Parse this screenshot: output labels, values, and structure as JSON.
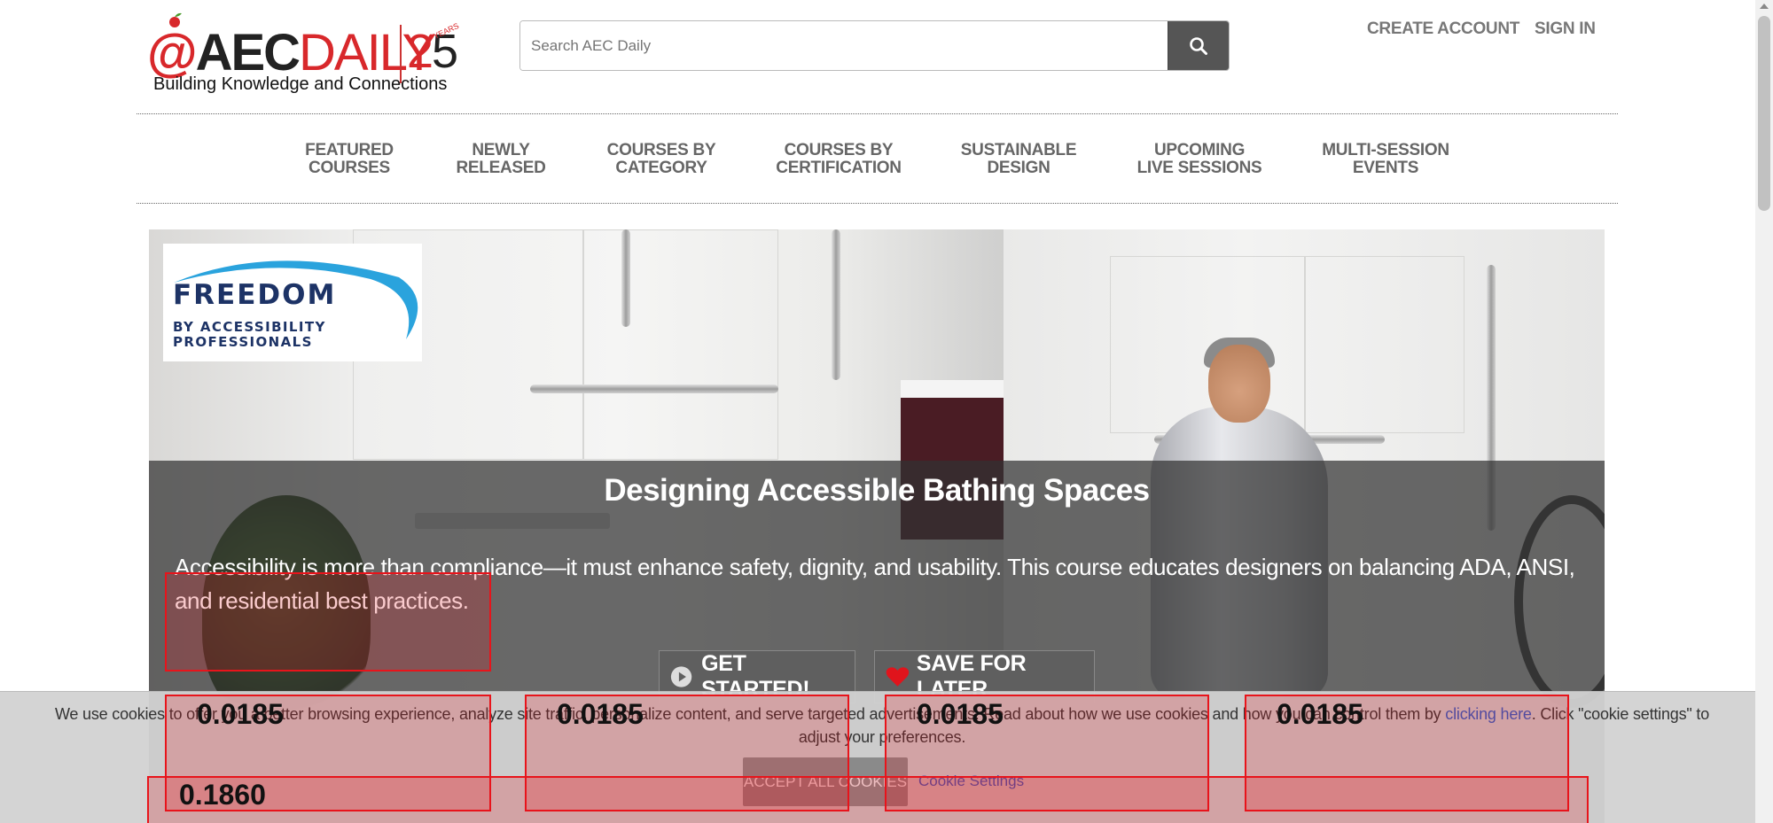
{
  "header": {
    "logo_at": "@",
    "logo_aec": "AEC",
    "logo_daily": "DAILY",
    "logo_25_two": "2",
    "logo_25_five": "5",
    "logo_years": "YEARS",
    "tagline": "Building Knowledge and Connections",
    "search_placeholder": "Search AEC Daily",
    "create_account": "CREATE ACCOUNT",
    "sign_in": "SIGN IN"
  },
  "nav": {
    "items": [
      {
        "label": "FEATURED\nCOURSES"
      },
      {
        "label": "NEWLY\nRELEASED"
      },
      {
        "label": "COURSES BY\nCATEGORY"
      },
      {
        "label": "COURSES BY\nCERTIFICATION"
      },
      {
        "label": "SUSTAINABLE\nDESIGN"
      },
      {
        "label": "UPCOMING\nLIVE SESSIONS"
      },
      {
        "label": "MULTI-SESSION\nEVENTS"
      }
    ]
  },
  "hero": {
    "brand_name": "FREEDOM",
    "brand_sub1": "BY ACCESSIBILITY",
    "brand_sub2": "PROFESSIONALS",
    "title": "Designing Accessible Bathing Spaces",
    "description": "Accessibility is more than compliance—it must enhance safety, dignity, and usability. This course educates designers on balancing ADA, ANSI, and residential best practices.",
    "get_started": "GET STARTED!",
    "save_for_later": "SAVE FOR LATER"
  },
  "cookie": {
    "icon": "",
    "text_before": " We use cookies to offer you a better browsing experience, analyze site traffic, personalize content, and serve targeted advertisements. Read about how we use cookies and how you can control them by ",
    "link_text": "clicking here",
    "text_after": ". Click \"cookie settings\" to adjust your preferences.",
    "accept_all": "ACCEPT ALL COOKIES",
    "cookie_settings": "Cookie Settings"
  },
  "annotations": {
    "values": [
      "0.0185",
      "0.0185",
      "0.0185",
      "0.0185",
      "0.1860"
    ]
  },
  "colors": {
    "brand_red": "#d8282b",
    "nav_gray": "#666666",
    "overlay": "#323232",
    "link_blue": "#2a5cc4",
    "annotation_red": "#e8141b"
  }
}
